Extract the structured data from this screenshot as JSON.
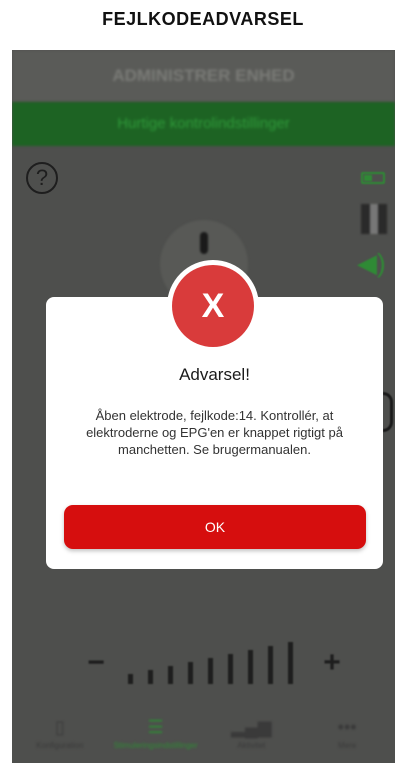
{
  "caption": "FEJLKODEADVARSEL",
  "app": {
    "header_title": "ADMINISTRER ENHED",
    "banner_text": "Hurtige kontrolindstillinger"
  },
  "icons": {
    "help": "question-circle-icon",
    "battery": "battery-icon",
    "epg": "epg-device-icon",
    "volume": "speaker-icon",
    "error": "x-icon"
  },
  "intensity": {
    "minus_label": "−",
    "plus_label": "+",
    "levels": 9,
    "bar_heights": [
      10,
      14,
      18,
      22,
      26,
      30,
      34,
      38,
      42
    ]
  },
  "bottom_nav": [
    {
      "label": "Konfiguration",
      "icon": "device-icon",
      "active": false
    },
    {
      "label": "Stimuleringsindstillinger",
      "icon": "equalizer-icon",
      "active": true
    },
    {
      "label": "Aktivitet",
      "icon": "bar-chart-icon",
      "active": false
    },
    {
      "label": "Mere",
      "icon": "more-icon",
      "active": false
    }
  ],
  "dialog": {
    "badge_symbol": "X",
    "title": "Advarsel!",
    "message": "Åben elektrode, fejlkode:14. Kontrollér, at elektroderne og EPG'en er knappet rigtigt på manchetten. Se brugermanualen.",
    "ok_label": "OK"
  },
  "colors": {
    "accent_red": "#d60e0e",
    "badge_red": "#d93b3b",
    "green": "#2f8a35",
    "overlay": "#4e4f4d"
  }
}
